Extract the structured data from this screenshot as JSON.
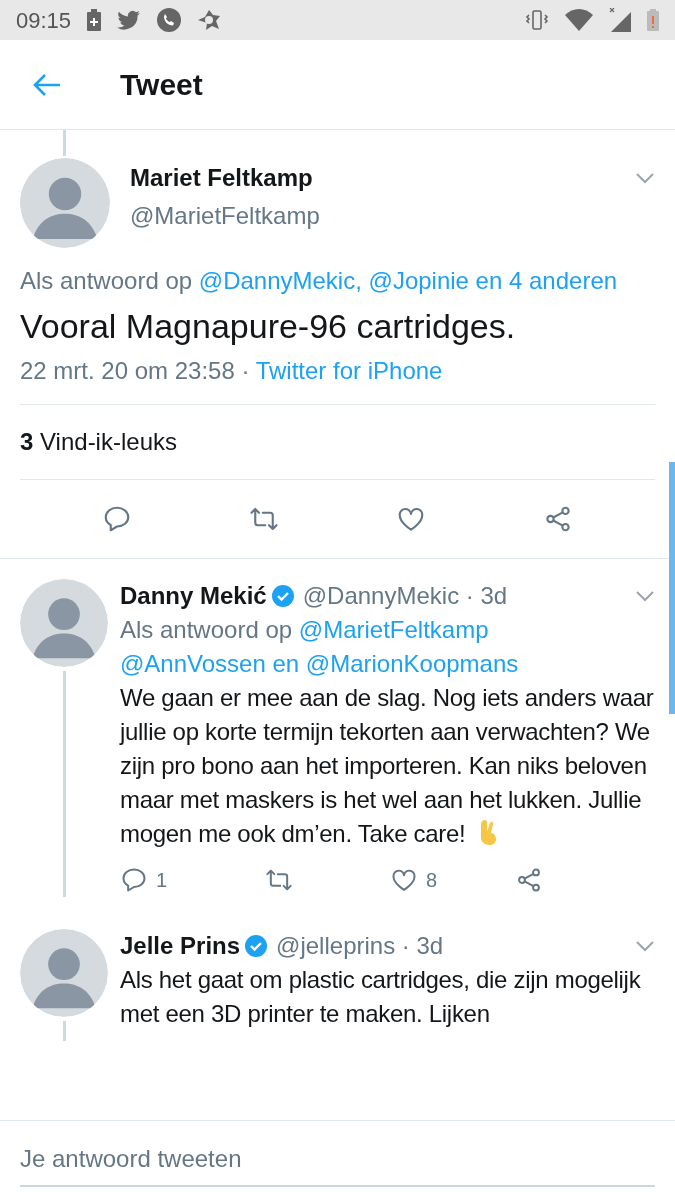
{
  "status_bar": {
    "time": "09:15"
  },
  "header": {
    "title": "Tweet"
  },
  "tweet": {
    "name": "Mariet Feltkamp",
    "handle": "@MarietFeltkamp",
    "reply_prefix": "Als antwoord op",
    "reply_links": [
      "@DannyMekic,",
      "@Jopinie en 4",
      "anderen"
    ],
    "text": "Vooral Magnapure-96 cartridges.",
    "date": "22 mrt. 20 om 23:58 ·",
    "source": "Twitter for iPhone",
    "likes": "**3** Vind-ik-leuks"
  },
  "replies": [
    {
      "name": "Danny Mekić",
      "verified": true,
      "handle": "@DannyMekic · 3d",
      "reply_prefix": "Als antwoord op",
      "reply_links": [
        "@MarietFeltkamp",
        "@AnnVossen en @MarionKoopmans"
      ],
      "text": "We gaan er mee aan de slag. Nog iets anders waar jullie op korte termijn tekorten aan verwachten? We zijn pro bono aan het importeren. Kan niks beloven maar met maskers is het wel aan het lukken. Jullie mogen me ook dm’en. Take care!",
      "emoji": true,
      "reply_count": "1",
      "like_count": "8",
      "thread_below": true
    },
    {
      "name": "Jelle Prins",
      "verified": true,
      "handle": "@jelleprins · 3d",
      "text": "Als het gaat om plastic cartridges, die zijn mogelijk met een 3D printer te maken. Lijken",
      "emoji": false,
      "thread_below": true
    }
  ],
  "composer": {
    "placeholder": "Je antwoord tweeten"
  }
}
